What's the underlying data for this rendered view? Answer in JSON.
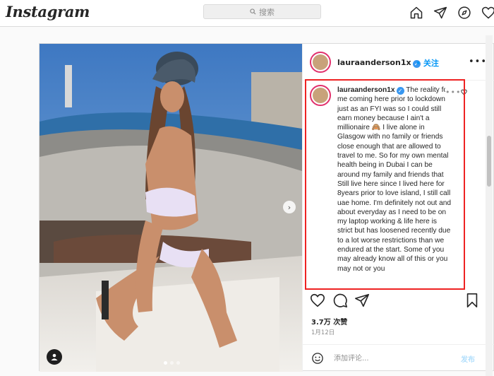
{
  "app": {
    "logo": "Instagram"
  },
  "search": {
    "placeholder": "搜索"
  },
  "nav": {
    "icons": [
      "home-icon",
      "direct-message-icon",
      "explore-icon",
      "activity-heart-icon"
    ]
  },
  "post": {
    "username": "lauraanderson1x",
    "verified": true,
    "follow_separator": "•",
    "follow_label": "关注",
    "caption": "The reality for me coming here prior to lockdown just as an FYI was so I could still earn money because I ain't a millionaire 🙈 I live alone in Glasgow with no family or friends close enough that are allowed to travel to me. So for my own mental health being in Dubai I can be around my family and friends that Still live here since I lived here for 8years prior to love island, I still call uae home. I'm definitely not out and about everyday as I need to be on my laptop working & life here is strict but has loosened recently due to a lot worse restrictions than we endured at the start. Some of you may already know all of this or you may not or you",
    "likes": "3.7万 次赞",
    "date": "1月12日",
    "comment_placeholder": "添加评论...",
    "post_label": "发布",
    "carousel_total": 3,
    "carousel_active": 1,
    "accent": "#0095f6",
    "highlight_color": "#ee2222"
  }
}
